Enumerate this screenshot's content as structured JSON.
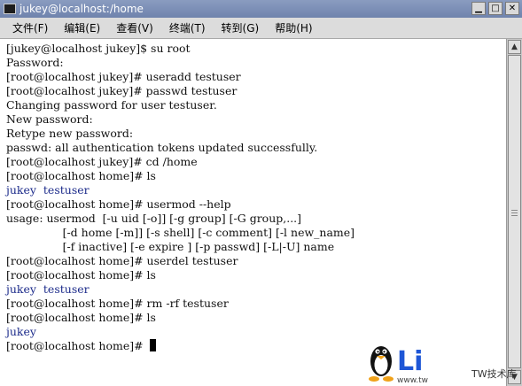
{
  "window": {
    "title": "jukey@localhost:/home",
    "controls": {
      "minimize": "▁",
      "maximize": "□",
      "close": "✕"
    }
  },
  "menu": [
    "文件(F)",
    "编辑(E)",
    "查看(V)",
    "终端(T)",
    "转到(G)",
    "帮助(H)"
  ],
  "terminal": {
    "lines": [
      {
        "text": "[jukey@localhost jukey]$ su root",
        "type": "normal"
      },
      {
        "text": "Password:",
        "type": "normal"
      },
      {
        "text": "[root@localhost jukey]# useradd testuser",
        "type": "normal"
      },
      {
        "text": "[root@localhost jukey]# passwd testuser",
        "type": "normal"
      },
      {
        "text": "Changing password for user testuser.",
        "type": "normal"
      },
      {
        "text": "New password:",
        "type": "normal"
      },
      {
        "text": "Retype new password:",
        "type": "normal"
      },
      {
        "text": "passwd: all authentication tokens updated successfully.",
        "type": "normal"
      },
      {
        "text": "[root@localhost jukey]# cd /home",
        "type": "normal"
      },
      {
        "text": "[root@localhost home]# ls",
        "type": "normal"
      },
      {
        "text": "jukey  testuser",
        "type": "dir"
      },
      {
        "text": "[root@localhost home]# usermod --help",
        "type": "normal"
      },
      {
        "text": "usage: usermod  [-u uid [-o]] [-g group] [-G group,...]",
        "type": "normal"
      },
      {
        "text": "                [-d home [-m]] [-s shell] [-c comment] [-l new_name]",
        "type": "normal"
      },
      {
        "text": "                [-f inactive] [-e expire ] [-p passwd] [-L|-U] name",
        "type": "normal"
      },
      {
        "text": "[root@localhost home]# userdel testuser",
        "type": "normal"
      },
      {
        "text": "[root@localhost home]# ls",
        "type": "normal"
      },
      {
        "text": "jukey  testuser",
        "type": "dir"
      },
      {
        "text": "[root@localhost home]# rm -rf testuser",
        "type": "normal"
      },
      {
        "text": "[root@localhost home]# ls",
        "type": "normal"
      },
      {
        "text": "jukey",
        "type": "dir"
      },
      {
        "text": "[root@localhost home]# ",
        "type": "prompt"
      }
    ]
  },
  "watermark": {
    "logo_text": "Li",
    "site_text": "www.tw",
    "brand_text": "TW技术库",
    "colors": {
      "logo_blue": "#1e56d6",
      "penguin_beak": "#f0a21b"
    }
  },
  "icons": {
    "terminal": "terminal-icon",
    "minimize": "minimize-icon",
    "maximize": "maximize-icon",
    "close": "close-icon",
    "scroll_up": "scroll-up-arrow-icon",
    "scroll_down": "scroll-down-arrow-icon",
    "penguin": "tux-penguin-icon"
  }
}
